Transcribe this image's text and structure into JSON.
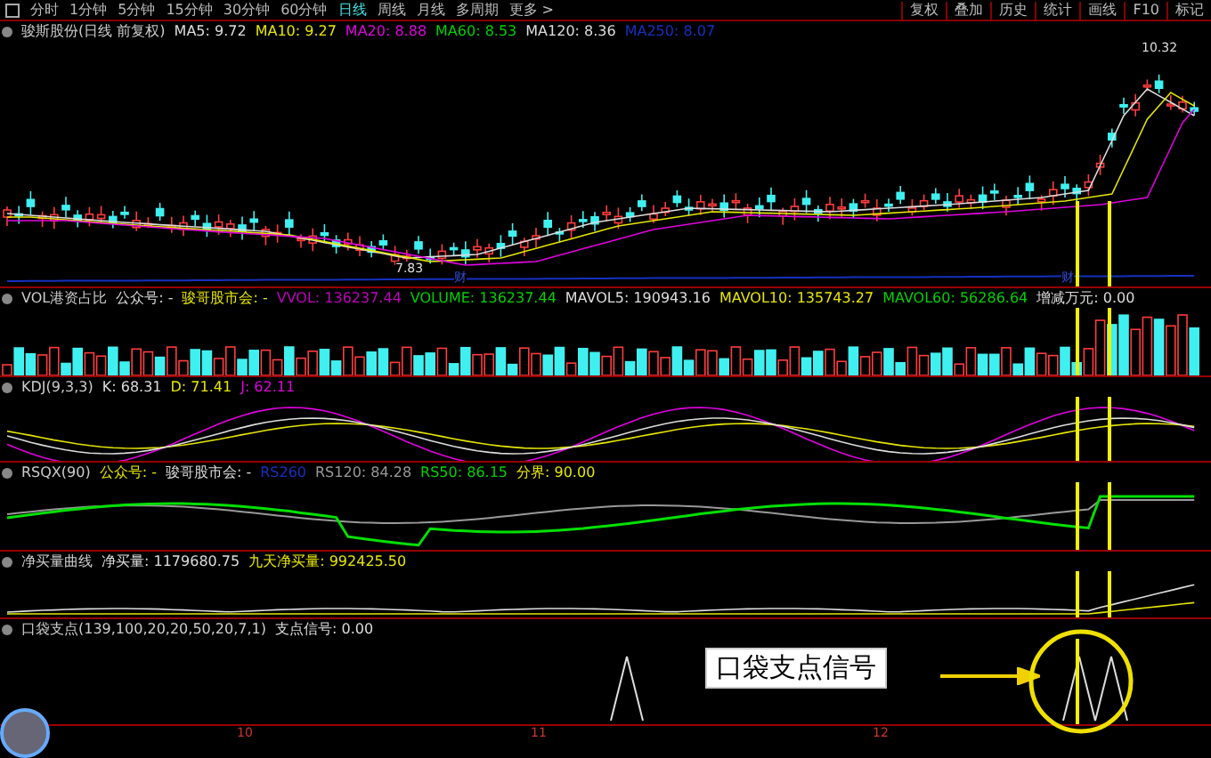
{
  "toolbar": {
    "tabs": [
      {
        "label": "分时",
        "selected": false
      },
      {
        "label": "1分钟",
        "selected": false
      },
      {
        "label": "5分钟",
        "selected": false
      },
      {
        "label": "15分钟",
        "selected": false
      },
      {
        "label": "30分钟",
        "selected": false
      },
      {
        "label": "60分钟",
        "selected": false
      },
      {
        "label": "日线",
        "selected": true
      },
      {
        "label": "周线",
        "selected": false
      },
      {
        "label": "月线",
        "selected": false
      },
      {
        "label": "多周期",
        "selected": false
      },
      {
        "label": "更多 >",
        "selected": false
      }
    ],
    "right_buttons": [
      "复权",
      "叠加",
      "历史",
      "统计",
      "画线",
      "F10",
      "标记"
    ]
  },
  "panes": [
    {
      "kind": "price",
      "title": "骏斯股份(日线 前复权)",
      "items": [
        {
          "text": "MA5: 9.72",
          "color": "#dddddd"
        },
        {
          "text": "MA10: 9.27",
          "color": "#e6e600"
        },
        {
          "text": "MA20: 8.88",
          "color": "#e000e0"
        },
        {
          "text": "MA60: 8.53",
          "color": "#00d000"
        },
        {
          "text": "MA120: 8.36",
          "color": "#dddddd"
        },
        {
          "text": "MA250: 8.07",
          "color": "#1530c0"
        }
      ],
      "high_label": "10.32",
      "low_label": "7.83",
      "event_marks": [
        "财",
        "财"
      ]
    },
    {
      "kind": "volume",
      "title": "VOL港资占比",
      "items": [
        {
          "text": "公众号: -",
          "color": "#dddddd"
        },
        {
          "text": "骏哥股市会: -",
          "color": "#e6e600"
        },
        {
          "text": "VVOL: 136237.44",
          "color": "#c000c0"
        },
        {
          "text": "VOLUME: 136237.44",
          "color": "#00d000"
        },
        {
          "text": "MAVOL5: 190943.16",
          "color": "#dddddd"
        },
        {
          "text": "MAVOL10: 135743.27",
          "color": "#e6e600"
        },
        {
          "text": "MAVOL60: 56286.64",
          "color": "#00d000"
        },
        {
          "text": "增减万元: 0.00",
          "color": "#dddddd"
        }
      ]
    },
    {
      "kind": "kdj",
      "title": "KDJ(9,3,3)",
      "items": [
        {
          "text": "K: 68.31",
          "color": "#dddddd"
        },
        {
          "text": "D: 71.41",
          "color": "#e6e600"
        },
        {
          "text": "J: 62.11",
          "color": "#e000e0"
        }
      ]
    },
    {
      "kind": "rsqx",
      "title": "RSQX(90)",
      "items": [
        {
          "text": "公众号: -",
          "color": "#e6e600"
        },
        {
          "text": "骏哥股市会: -",
          "color": "#dddddd"
        },
        {
          "text": "RS260",
          "color": "#1530c0"
        },
        {
          "text": "RS120: 84.28",
          "color": "#999999"
        },
        {
          "text": "RS50: 86.15",
          "color": "#00d000"
        },
        {
          "text": "分界: 90.00",
          "color": "#e6e600"
        }
      ]
    },
    {
      "kind": "netbuy",
      "title": "净买量曲线",
      "items": [
        {
          "text": "净买量: 1179680.75",
          "color": "#dddddd"
        },
        {
          "text": "九天净买量: 992425.50",
          "color": "#e6e600"
        }
      ]
    },
    {
      "kind": "pocket",
      "title": "口袋支点(139,100,20,20,50,20,7,1)",
      "items": [
        {
          "text": "支点信号: 0.00",
          "color": "#dddddd"
        }
      ],
      "callout": "口袋支点信号"
    }
  ],
  "axis_labels": [
    "10",
    "11",
    "12"
  ]
}
